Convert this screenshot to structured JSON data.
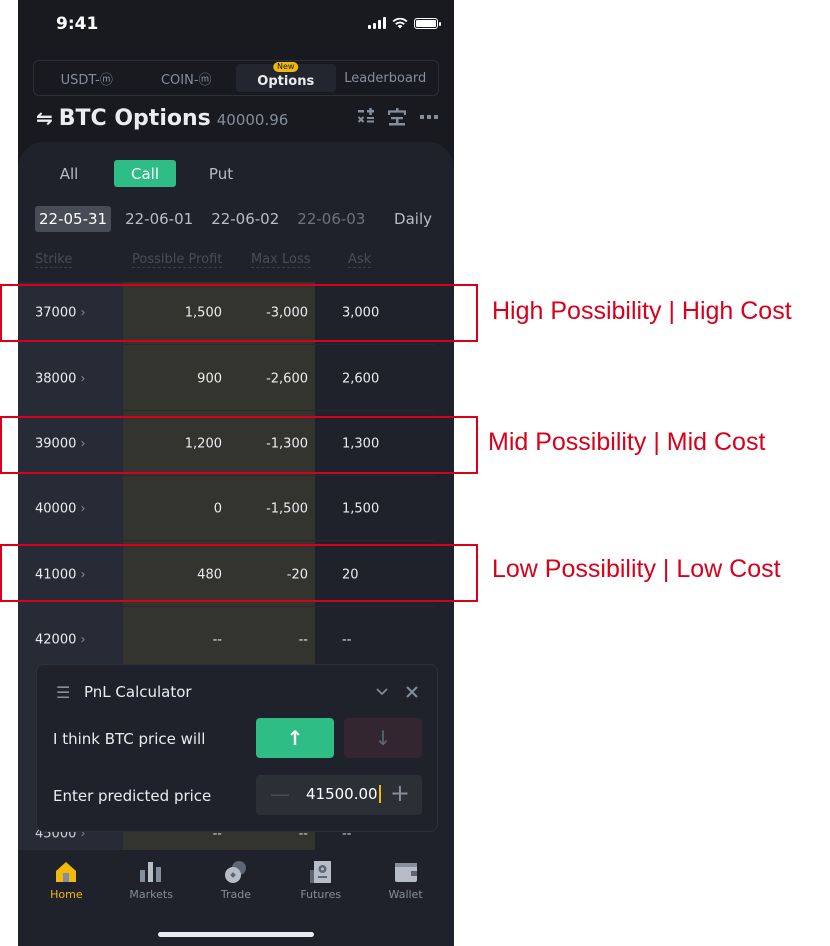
{
  "status_bar": {
    "time": "9:41"
  },
  "top_tabs": [
    {
      "label": "USDT-ⓜ",
      "active": false
    },
    {
      "label": "COIN-ⓜ",
      "active": false
    },
    {
      "label": "Options",
      "active": true,
      "badge": "New"
    },
    {
      "label": "Leaderboard",
      "active": false
    }
  ],
  "header": {
    "title": "BTC Options",
    "price": "40000.96",
    "swap_icon": "⇋"
  },
  "type_tabs": [
    {
      "label": "All"
    },
    {
      "label": "Call",
      "active": true
    },
    {
      "label": "Put"
    }
  ],
  "dates": [
    "22-05-31",
    "22-06-01",
    "22-06-02",
    "22-06-03"
  ],
  "daily_label": "Daily",
  "columns": {
    "strike": "Strike",
    "profit": "Possible Profit",
    "loss": "Max Loss",
    "ask": "Ask"
  },
  "rows": [
    {
      "strike": "37000",
      "profit": "1,500",
      "loss": "-3,000",
      "ask": "3,000"
    },
    {
      "strike": "38000",
      "profit": "900",
      "loss": "-2,600",
      "ask": "2,600"
    },
    {
      "strike": "39000",
      "profit": "1,200",
      "loss": "-1,300",
      "ask": "1,300"
    },
    {
      "strike": "40000",
      "profit": "0",
      "loss": "-1,500",
      "ask": "1,500"
    },
    {
      "strike": "41000",
      "profit": "480",
      "loss": "-20",
      "ask": "20"
    },
    {
      "strike": "42000",
      "profit": "--",
      "loss": "--",
      "ask": "--"
    },
    {
      "strike": "45000",
      "profit": "--",
      "loss": "--",
      "ask": "--"
    }
  ],
  "pnl": {
    "title": "PnL Calculator",
    "direction_label": "I think BTC price will",
    "price_label": "Enter predicted price",
    "price_value": "41500.00",
    "up_arrow": "↑",
    "down_arrow": "↓",
    "minus": "—",
    "plus": "+"
  },
  "bottom_nav": [
    {
      "label": "Home",
      "active": true
    },
    {
      "label": "Markets"
    },
    {
      "label": "Trade"
    },
    {
      "label": "Futures"
    },
    {
      "label": "Wallet"
    }
  ],
  "annotations": [
    {
      "text": "High Possibility | High Cost"
    },
    {
      "text": "Mid Possibility | Mid Cost"
    },
    {
      "text": "Low Possibility | Low Cost"
    }
  ],
  "colors": {
    "accent_green": "#2ebd85",
    "brand_yellow": "#f0b90b",
    "annotation_red": "#d9001b",
    "background": "#181a20"
  }
}
